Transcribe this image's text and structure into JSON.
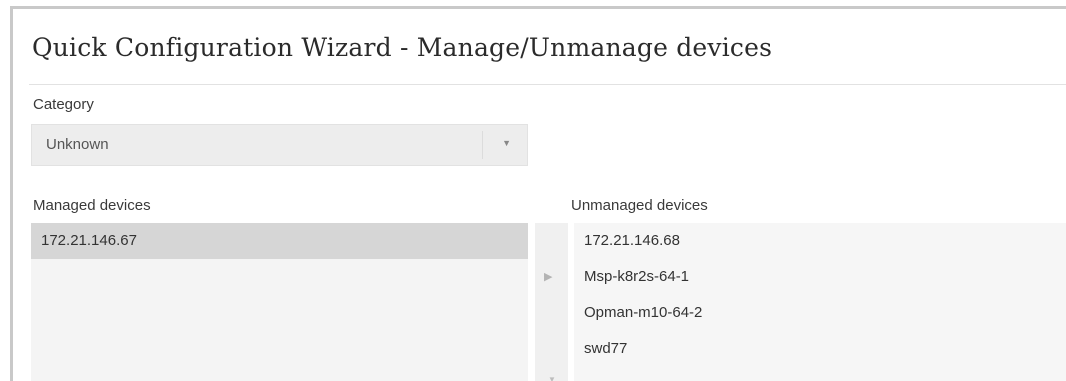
{
  "window": {
    "title": "Quick Configuration Wizard - Manage/Unmanage devices"
  },
  "category": {
    "label": "Category",
    "selected": "Unknown",
    "arrow_icon": "chevron-down-icon"
  },
  "managed": {
    "label": "Managed devices",
    "items": [
      "172.21.146.67"
    ],
    "selected_index": 0
  },
  "unmanaged": {
    "label": "Unmanaged devices",
    "items": [
      "172.21.146.68",
      "Msp-k8r2s-64-1",
      "Opman-m10-64-2",
      "swd77"
    ]
  },
  "transfer": {
    "move_icon": "triangle-right-icon"
  },
  "colors": {
    "selected_row": "#d6d6d6",
    "select_bg": "#ededed",
    "frame_border": "#c9c9c9"
  }
}
